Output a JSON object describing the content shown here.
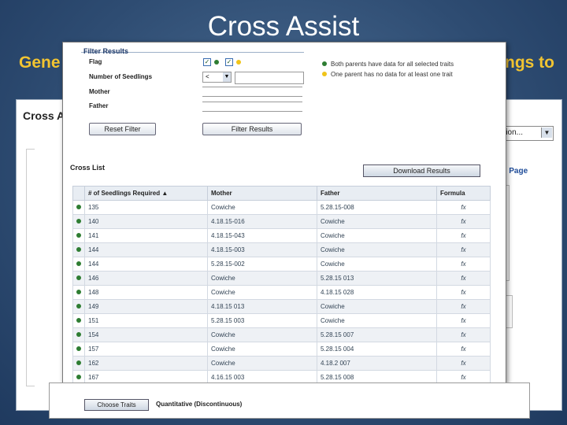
{
  "slide": {
    "title": "Cross Assist",
    "subtitle_left": "Gene",
    "subtitle_right": "ngs to"
  },
  "background_app": {
    "title": "Cross A",
    "select_value": "ation...",
    "link_text": "ets Page"
  },
  "filter": {
    "header": "Filter Results",
    "flag_label": "Flag",
    "seedlings_label": "Number of Seedlings",
    "seedlings_op": "<",
    "mother_label": "Mother",
    "father_label": "Father",
    "reset_button": "Reset Filter",
    "filter_button": "Filter Results",
    "legend_green": "Both parents have data for all selected traits",
    "legend_yellow": "One parent has no data for at least one trait",
    "colors": {
      "green": "#2e7d32",
      "yellow": "#f0c419"
    }
  },
  "cross_list": {
    "title": "Cross List",
    "download_button": "Download Results",
    "columns": [
      "# of Seedlings Required ▲",
      "Mother",
      "Father",
      "Formula"
    ],
    "rows": [
      {
        "seedlings": "135",
        "mother": "Cowiche",
        "father": "5.28.15-008",
        "formula": "fx"
      },
      {
        "seedlings": "140",
        "mother": "4.18.15-016",
        "father": "Cowiche",
        "formula": "fx"
      },
      {
        "seedlings": "141",
        "mother": "4.18.15-043",
        "father": "Cowiche",
        "formula": "fx"
      },
      {
        "seedlings": "144",
        "mother": "4.18.15-003",
        "father": "Cowiche",
        "formula": "fx"
      },
      {
        "seedlings": "144",
        "mother": "5.28.15-002",
        "father": "Cowiche",
        "formula": "fx"
      },
      {
        "seedlings": "146",
        "mother": "Cowiche",
        "father": "5.28.15 013",
        "formula": "fx"
      },
      {
        "seedlings": "148",
        "mother": "Cowiche",
        "father": "4.18.15 028",
        "formula": "fx"
      },
      {
        "seedlings": "149",
        "mother": "4.18.15 013",
        "father": "Cowiche",
        "formula": "fx"
      },
      {
        "seedlings": "151",
        "mother": "5.28.15 003",
        "father": "Cowiche",
        "formula": "fx"
      },
      {
        "seedlings": "154",
        "mother": "Cowiche",
        "father": "5.28.15 007",
        "formula": "fx"
      },
      {
        "seedlings": "157",
        "mother": "Cowiche",
        "father": "5.28.15 004",
        "formula": "fx"
      },
      {
        "seedlings": "162",
        "mother": "Cowiche",
        "father": "4.18.2 007",
        "formula": "fx"
      },
      {
        "seedlings": "167",
        "mother": "4.16.15 003",
        "father": "5.28.15 008",
        "formula": "fx"
      }
    ]
  },
  "bottom": {
    "choose_traits": "Choose Traits",
    "quantitative": "Quantitative (Discontinuous)"
  }
}
